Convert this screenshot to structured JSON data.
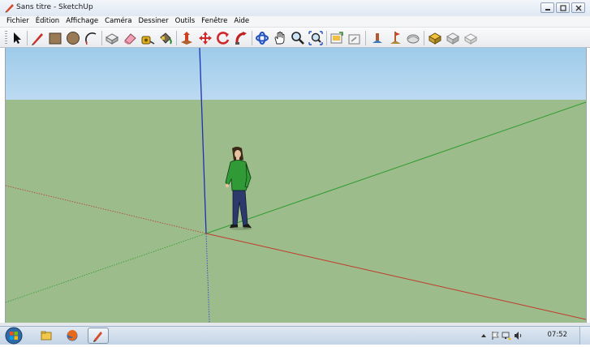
{
  "window": {
    "title": "Sans titre - SketchUp",
    "controls": [
      "minimize-icon",
      "maximize-icon",
      "close-icon"
    ]
  },
  "menubar": {
    "items": [
      "Fichier",
      "Édition",
      "Affichage",
      "Caméra",
      "Dessiner",
      "Outils",
      "Fenêtre",
      "Aide"
    ]
  },
  "toolbar": {
    "tools": [
      "select-arrow-icon",
      "pencil-line-icon",
      "rectangle-icon",
      "circle-icon",
      "arc-icon",
      "make-component-icon",
      "eraser-icon",
      "tape-measure-icon",
      "paint-bucket-icon",
      "push-pull-icon",
      "move-icon",
      "rotate-icon",
      "follow-me-icon",
      "orbit-icon",
      "pan-hand-icon",
      "zoom-icon",
      "zoom-extents-icon",
      "get-models-icon",
      "share-model-icon",
      "google-earth-icon",
      "add-location-icon",
      "toggle-terrain-icon",
      "components-icon",
      "share-component-icon",
      "warehouse-icon"
    ]
  },
  "viewport": {
    "sky_color": "#b3d6ef",
    "ground_color": "#9cbd8b",
    "axes": {
      "red": "#c0392b",
      "green": "#2e9a2e",
      "blue": "#1f2fb5"
    },
    "figure": "person-figure"
  },
  "taskbar": {
    "clock": "07:52",
    "pinned": [
      "windows-start-icon",
      "file-explorer-icon",
      "firefox-icon",
      "sketchup-taskbar-icon"
    ],
    "tray": [
      "tray-expand-icon",
      "tray-flag-icon",
      "tray-network-icon",
      "tray-volume-icon"
    ]
  }
}
